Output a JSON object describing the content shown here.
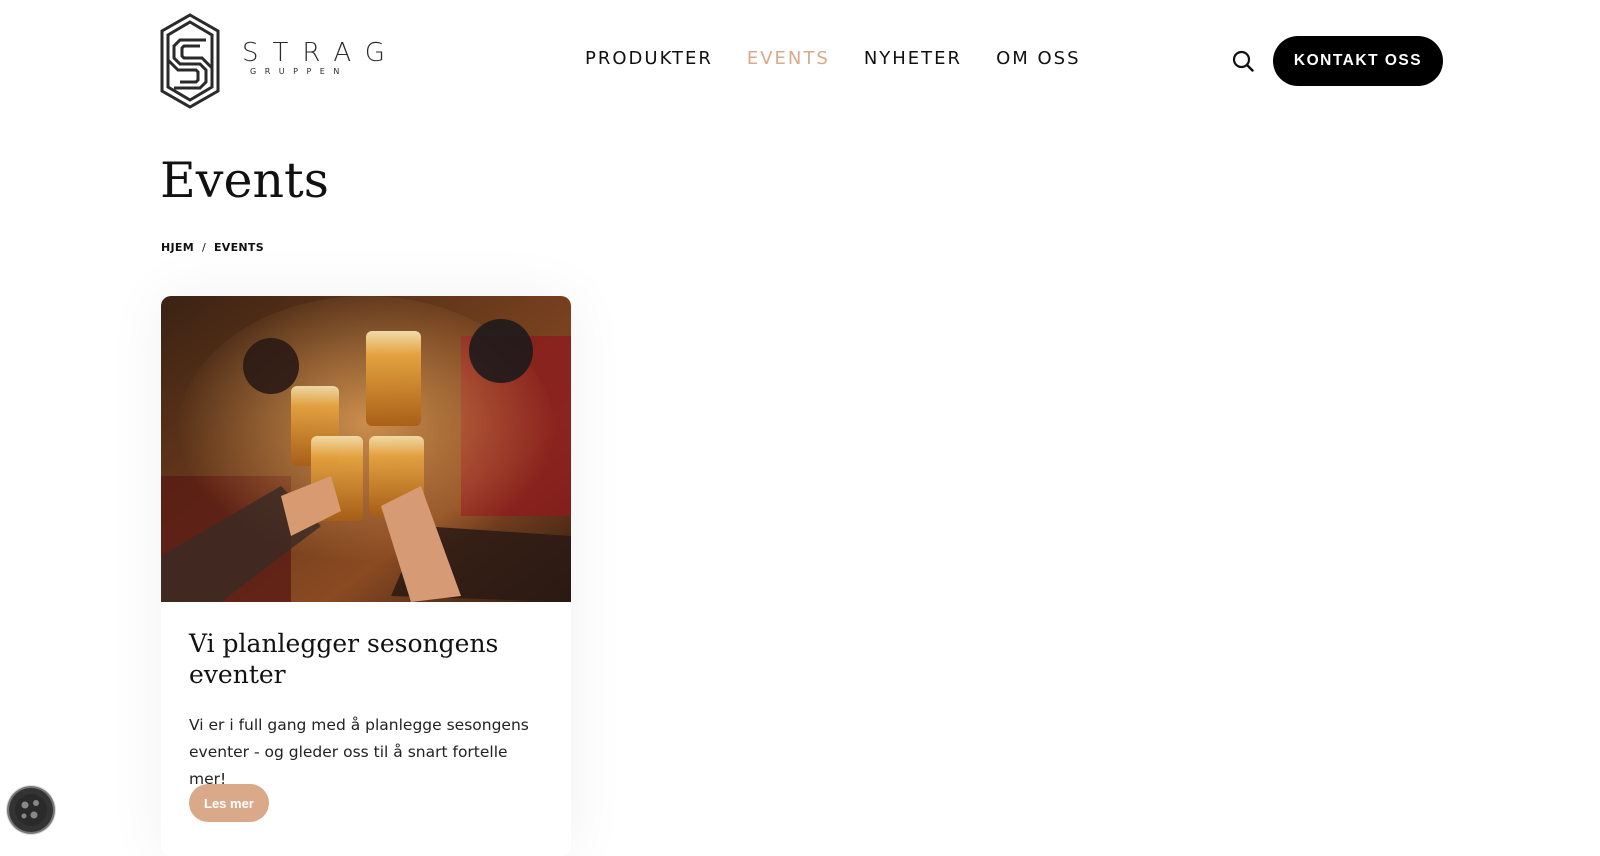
{
  "header": {
    "logo": {
      "word": "STRAG",
      "sub": "GRUPPEN"
    },
    "nav": [
      {
        "label": "PRODUKTER",
        "active": false
      },
      {
        "label": "EVENTS",
        "active": true
      },
      {
        "label": "NYHETER",
        "active": false
      },
      {
        "label": "OM OSS",
        "active": false
      }
    ],
    "search_icon": "search-icon",
    "cta_label": "KONTAKT OSS"
  },
  "page": {
    "title": "Events",
    "breadcrumb": {
      "home": "HJEM",
      "sep": "/",
      "current": "EVENTS"
    }
  },
  "card": {
    "image": "beer-toast-image",
    "title": "Vi planlegger sesongens eventer",
    "text": "Vi er i full gang med å planlegge sesongens eventer - og gleder oss til å snart fortelle mer!",
    "button_label": "Les mer"
  },
  "cookie_icon": "cookie-icon",
  "colors": {
    "accent": "#d9a98a",
    "cta_bg": "#000000",
    "text": "#111111"
  }
}
